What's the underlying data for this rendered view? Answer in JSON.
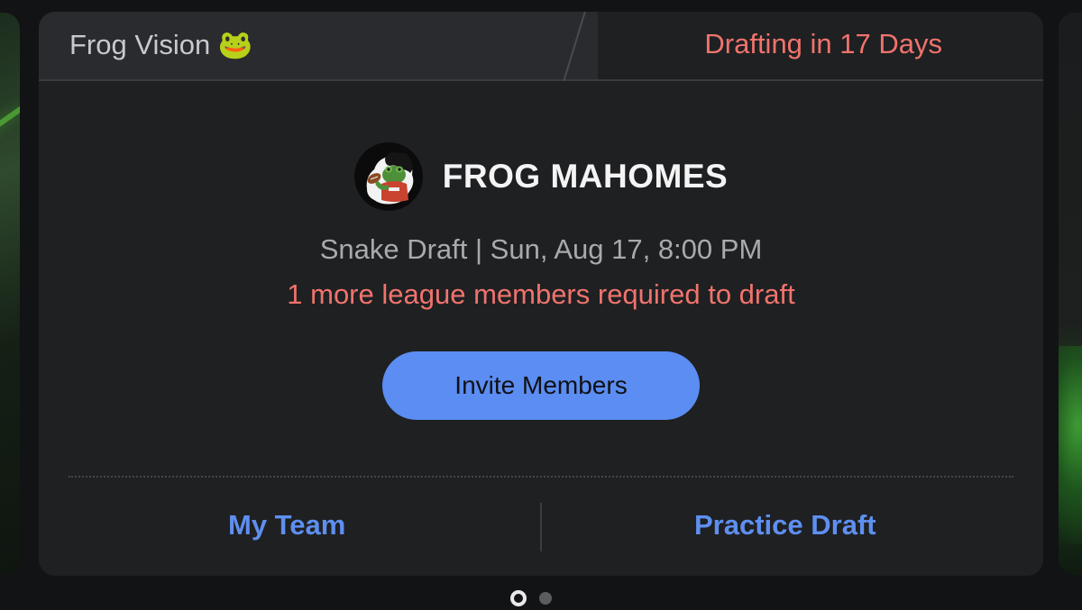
{
  "header": {
    "league_name": "Frog Vision 🐸",
    "draft_countdown": "Drafting in 17 Days"
  },
  "team": {
    "name": "FROG MAHOMES",
    "avatar_icon": "frog-mascot-avatar"
  },
  "draft": {
    "info": "Snake Draft | Sun, Aug 17, 8:00 PM",
    "members_required": "1 more league members required to draft"
  },
  "actions": {
    "invite_label": "Invite Members",
    "my_team_label": "My Team",
    "practice_draft_label": "Practice Draft"
  },
  "pager": {
    "total": 2,
    "active": 1
  },
  "colors": {
    "accent_blue": "#5b8df2",
    "alert_red": "#f0736d",
    "card_bg": "#1f2022"
  }
}
